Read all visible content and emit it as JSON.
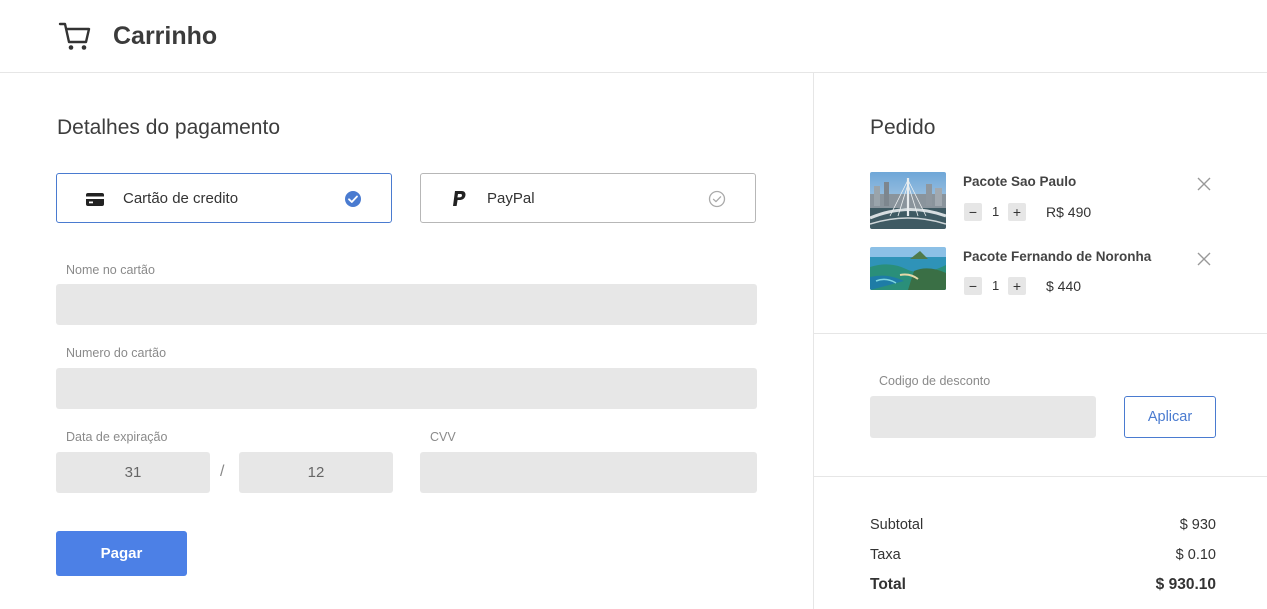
{
  "header": {
    "title": "Carrinho",
    "icon": "cart-icon"
  },
  "payment": {
    "title": "Detalhes do pagamento",
    "options": [
      {
        "label": "Cartão de credito",
        "icon": "credit-card-icon",
        "selected": true
      },
      {
        "label": "PayPal",
        "icon": "paypal-icon",
        "selected": false
      }
    ],
    "fields": {
      "card_name_label": "Nome no cartão",
      "card_name_value": "",
      "card_number_label": "Numero do cartão",
      "card_number_value": "",
      "expiry_label": "Data de expiração",
      "expiry_day": "31",
      "expiry_separator": "/",
      "expiry_month": "12",
      "cvv_label": "CVV",
      "cvv_value": ""
    },
    "pay_button": "Pagar"
  },
  "order": {
    "title": "Pedido",
    "items": [
      {
        "name": "Pacote Sao Paulo",
        "quantity": "1",
        "price": "R$ 490",
        "image": "sao-paulo-bridge-photo"
      },
      {
        "name": "Pacote Fernando de Noronha",
        "quantity": "1",
        "price": "$ 440",
        "image": "noronha-beach-photo"
      }
    ],
    "qty_minus": "−",
    "qty_plus": "+",
    "discount_label": "Codigo de desconto",
    "discount_value": "",
    "apply_button": "Aplicar",
    "summary": {
      "subtotal_label": "Subtotal",
      "subtotal_value": "$ 930",
      "tax_label": "Taxa",
      "tax_value": "$ 0.10",
      "total_label": "Total",
      "total_value": "$ 930.10"
    }
  },
  "colors": {
    "accent": "#4c80e6",
    "field_bg": "#e7e7e7",
    "border": "#e6e6e6"
  }
}
